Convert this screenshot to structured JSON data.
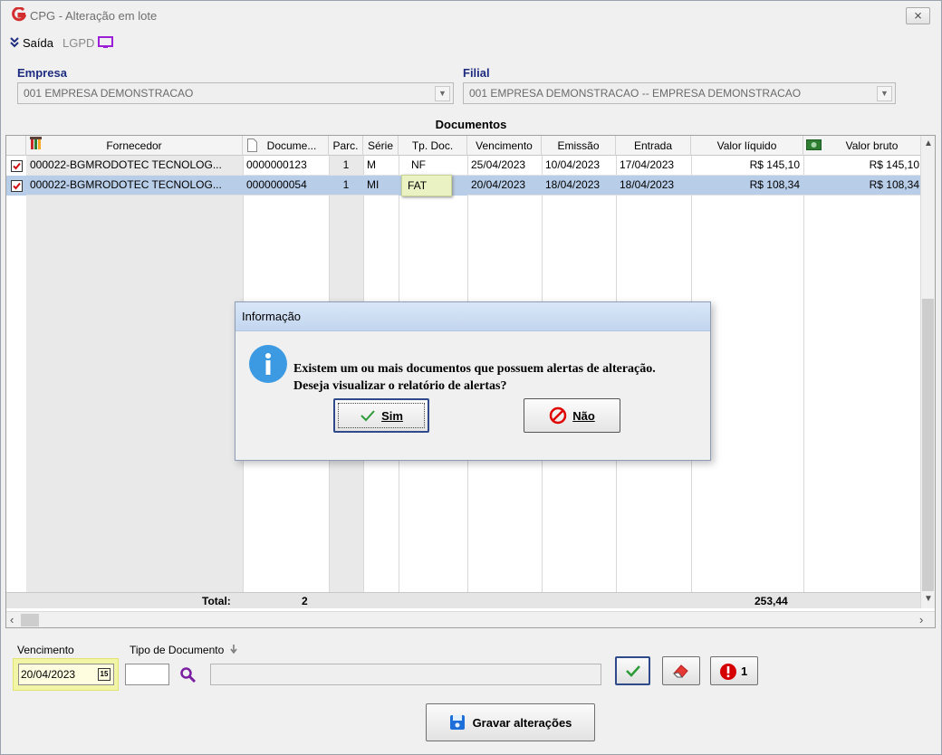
{
  "window": {
    "title": "CPG - Alteração em lote",
    "close_glyph": "⨯"
  },
  "menu": {
    "saida": "Saída",
    "lgpd": "LGPD"
  },
  "empresa": {
    "label": "Empresa",
    "value": "001 EMPRESA DEMONSTRACAO"
  },
  "filial": {
    "label": "Filial",
    "value": "001 EMPRESA DEMONSTRACAO -- EMPRESA DEMONSTRACAO"
  },
  "grid": {
    "title": "Documentos",
    "columns": [
      "Fornecedor",
      "Docume...",
      "Parc.",
      "Série",
      "Tp. Doc.",
      "Vencimento",
      "Emissão",
      "Entrada",
      "Valor líquido",
      "Valor bruto"
    ],
    "rows": [
      {
        "fornecedor": "000022-BGMRODOTEC TECNOLOG...",
        "documento": "0000000123",
        "parc": "1",
        "serie": "M",
        "tp_doc": "NF",
        "vencimento": "25/04/2023",
        "emissao": "10/04/2023",
        "entrada": "17/04/2023",
        "valor_liquido": "R$ 145,10",
        "valor_bruto": "R$ 145,10",
        "checked": true
      },
      {
        "fornecedor": "000022-BGMRODOTEC TECNOLOG...",
        "documento": "0000000054",
        "parc": "1",
        "serie": "MI",
        "tp_doc": "FAT",
        "vencimento": "20/04/2023",
        "emissao": "18/04/2023",
        "entrada": "18/04/2023",
        "valor_liquido": "R$ 108,34",
        "valor_bruto": "R$ 108,34",
        "checked": true
      }
    ],
    "footer": {
      "total_label": "Total:",
      "count": "2",
      "sum": "253,44"
    }
  },
  "bottom": {
    "vencimento_label": "Vencimento",
    "vencimento_value": "20/04/2023",
    "calendar_glyph": "15",
    "tipo_label": "Tipo de Documento",
    "alert_count": "1",
    "gravar_label": "Gravar alterações"
  },
  "dialog": {
    "title": "Informação",
    "message_line1": "Existem um ou mais documentos que possuem alertas de alteração.",
    "message_line2": "Deseja visualizar o relatório de alertas?",
    "yes_label": "Sim",
    "no_label": "Não"
  },
  "colors": {
    "accent_blue": "#1d2b80",
    "selected_row": "#b8cde8",
    "highlight_yellow": "#f2f4a6",
    "logo_red": "#d32f2f"
  }
}
